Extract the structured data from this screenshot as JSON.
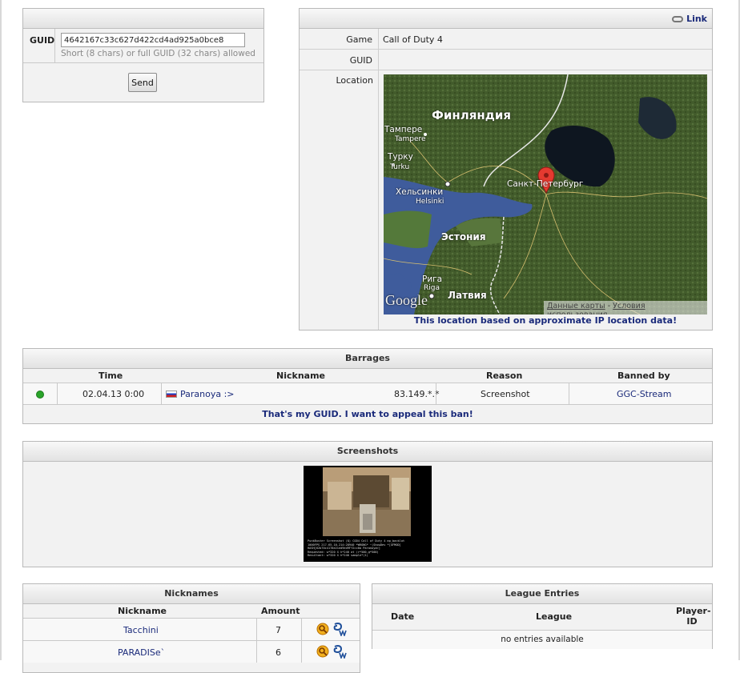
{
  "guid_form": {
    "label": "GUID",
    "value": "4642167c33c627d422cd4ad925a0bce8",
    "hint": "Short (8 chars) or full GUID (32 chars) allowed",
    "send_label": "Send"
  },
  "info": {
    "link_label": "Link",
    "game_label": "Game",
    "game_value": "Call of Duty 4",
    "guid_label": "GUID",
    "guid_value": "",
    "location_label": "Location",
    "map": {
      "finland": "Финляндия",
      "tampere_ru": "Тампере",
      "tampere_en": "Tampere",
      "turku_ru": "Турку",
      "turku_en": "Turku",
      "helsinki_ru": "Хельсинки",
      "helsinki_en": "Helsinki",
      "spb": "Санкт-Петербург",
      "estonia": "Эстония",
      "riga_ru": "Рига",
      "riga_en": "Riga",
      "latvia": "Латвия",
      "google": "Google",
      "map_data": "Данные карты",
      "separator": "-",
      "terms": "Условия использования"
    },
    "caption": "This location based on approximate IP location data!"
  },
  "barrages": {
    "title": "Barrages",
    "headers": {
      "time": "Time",
      "nickname": "Nickname",
      "reason": "Reason",
      "banned_by": "Banned by"
    },
    "rows": [
      {
        "time": "02.04.13 0:00",
        "nickname": "Paranoya :>",
        "ip": "83.149.*.*",
        "reason": "Screenshot",
        "banned_by": "GGC-Stream"
      }
    ],
    "appeal": "That's my GUID. I want to appeal this ban!"
  },
  "screenshots": {
    "title": "Screenshots",
    "overlay_lines": [
      "PunkBuster Screenshot (ß) COD4 Call of Duty 4 mp_backlot",
      "1000FPS 217.65.10.214:28940 *WRONG* ~|ShowDev *[GFMOD]",
      "HASH[62b70c4178e21ed9ed9Ff2cc0a Paranoya>]",
      "Requested: w*320 X h*240 at (r*500,g*500)",
      "Resultant: w*320 X h*240 sample*(1)"
    ]
  },
  "nicknames": {
    "title": "Nicknames",
    "headers": {
      "nickname": "Nickname",
      "amount": "Amount"
    },
    "rows": [
      {
        "nickname": "Tacchini",
        "amount": "7"
      },
      {
        "nickname": "PARADISe`",
        "amount": "6"
      }
    ],
    "colors": {
      "search_icon": "#e89a10",
      "gm_icon": "#1f4f9a"
    }
  },
  "league": {
    "title": "League Entries",
    "headers": {
      "date": "Date",
      "league": "League",
      "player_id": "Player-ID"
    },
    "empty": "no entries available"
  }
}
